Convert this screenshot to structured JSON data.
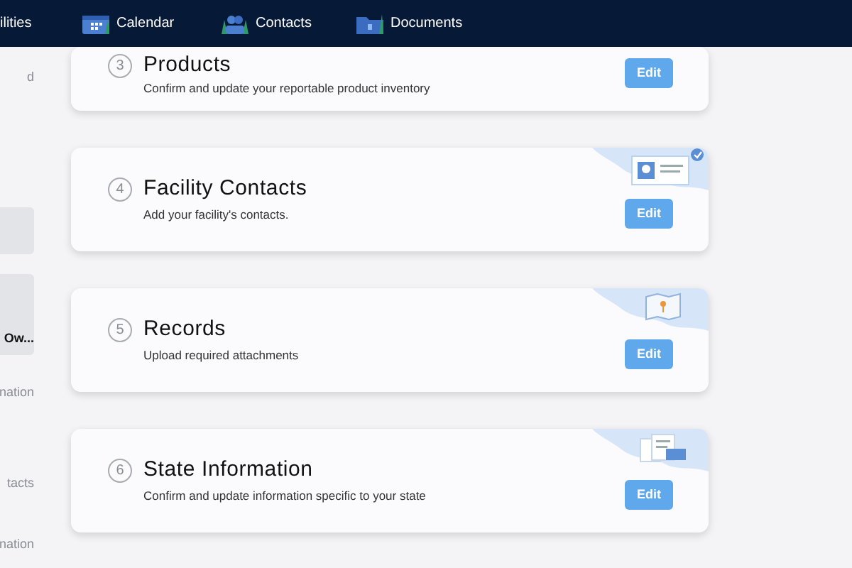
{
  "nav": {
    "items": [
      {
        "label": "ilities"
      },
      {
        "label": "Calendar"
      },
      {
        "label": "Contacts"
      },
      {
        "label": "Documents"
      }
    ]
  },
  "sidebar": {
    "items": [
      {
        "kind": "text",
        "label": "d"
      },
      {
        "kind": "tile"
      },
      {
        "kind": "tile",
        "label": "Ow..."
      },
      {
        "kind": "text",
        "label": "nation"
      },
      {
        "kind": "text",
        "label": "tacts"
      },
      {
        "kind": "text",
        "label": "nation"
      }
    ]
  },
  "steps": [
    {
      "number": "3",
      "title": "Products",
      "description": "Confirm and update your reportable product inventory",
      "button": "Edit"
    },
    {
      "number": "4",
      "title": "Facility Contacts",
      "description": "Add your facility's contacts.",
      "button": "Edit"
    },
    {
      "number": "5",
      "title": "Records",
      "description": "Upload required attachments",
      "button": "Edit"
    },
    {
      "number": "6",
      "title": "State Information",
      "description": "Confirm and update information specific to your state",
      "button": "Edit"
    }
  ]
}
